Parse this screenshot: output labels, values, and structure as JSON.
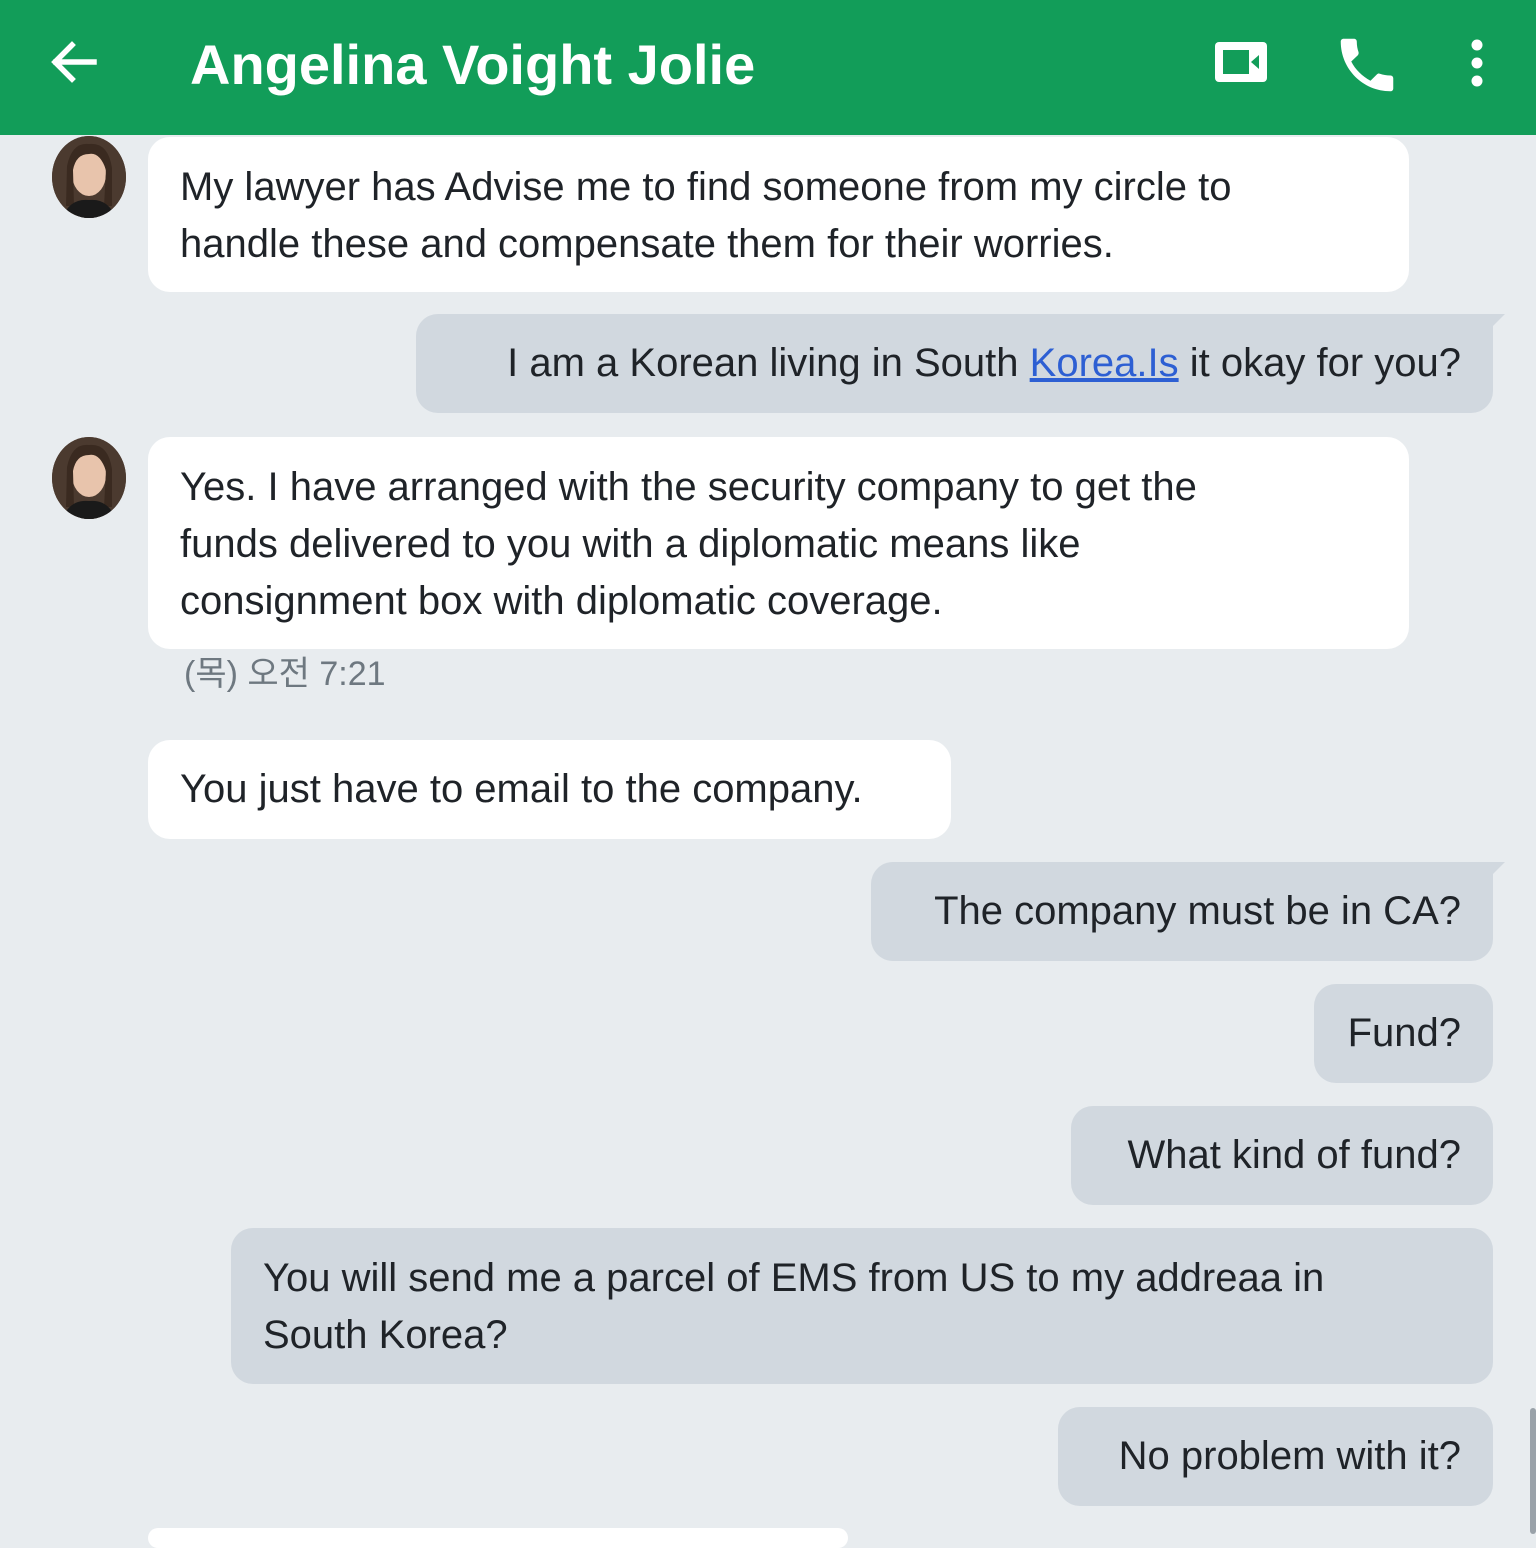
{
  "header": {
    "title": "Angelina Voight Jolie",
    "back_icon": "arrow-left-icon",
    "video_icon": "video-call-icon",
    "phone_icon": "phone-icon",
    "more_icon": "more-vert-icon",
    "bg_color": "#129d59"
  },
  "messages": [
    {
      "side": "in",
      "text_lines": [
        "My lawyer has Advise me to find someone from my circle to",
        "handle these and compensate them for their worries."
      ]
    },
    {
      "side": "out",
      "before": "I am a Korean living in South ",
      "link": "Korea.Is",
      "after": " it okay for you?"
    },
    {
      "side": "in",
      "text_lines": [
        "Yes. I have arranged with the security company to get the",
        "funds delivered to you with a diplomatic means like",
        "consignment box with diplomatic coverage."
      ],
      "timestamp": "(목) 오전 7:21"
    },
    {
      "side": "in",
      "text": "You just have to email to the company."
    },
    {
      "side": "out",
      "text": "The company must be in CA?"
    },
    {
      "side": "out",
      "text": "Fund?"
    },
    {
      "side": "out",
      "text": "What kind of fund?"
    },
    {
      "side": "out",
      "text_lines": [
        "You will send me a parcel of EMS from US to my addreaa in",
        "South Korea?"
      ]
    },
    {
      "side": "out",
      "text": "No problem with it?"
    }
  ]
}
